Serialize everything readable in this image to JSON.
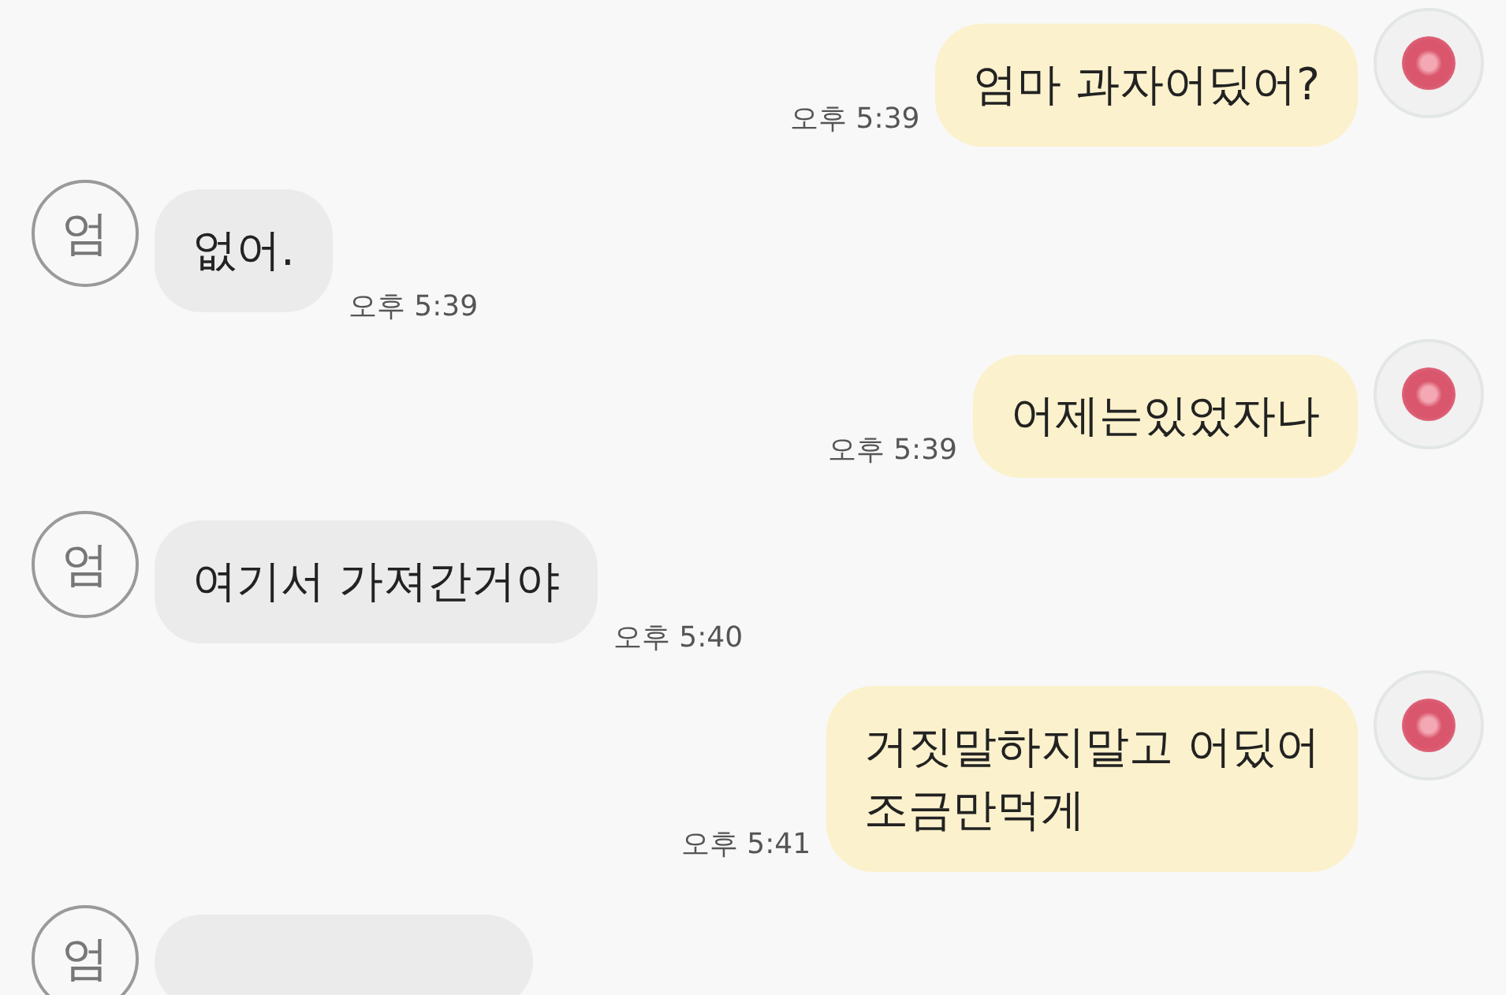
{
  "messages": [
    {
      "kind": "sent",
      "text": "엄마 과자어딨어?",
      "time": "오후 5:39"
    },
    {
      "kind": "received",
      "avatar": "엄",
      "text": "없어.",
      "time": "오후 5:39"
    },
    {
      "kind": "sent",
      "text": "어제는있었자나",
      "time": "오후 5:39"
    },
    {
      "kind": "received",
      "avatar": "엄",
      "text": "여기서 가져간거야",
      "time": "오후 5:40"
    },
    {
      "kind": "sent",
      "text": "거짓말하지말고 어딨어\n조금만먹게",
      "time": "오후 5:41"
    },
    {
      "kind": "received",
      "avatar": "엄"
    }
  ]
}
